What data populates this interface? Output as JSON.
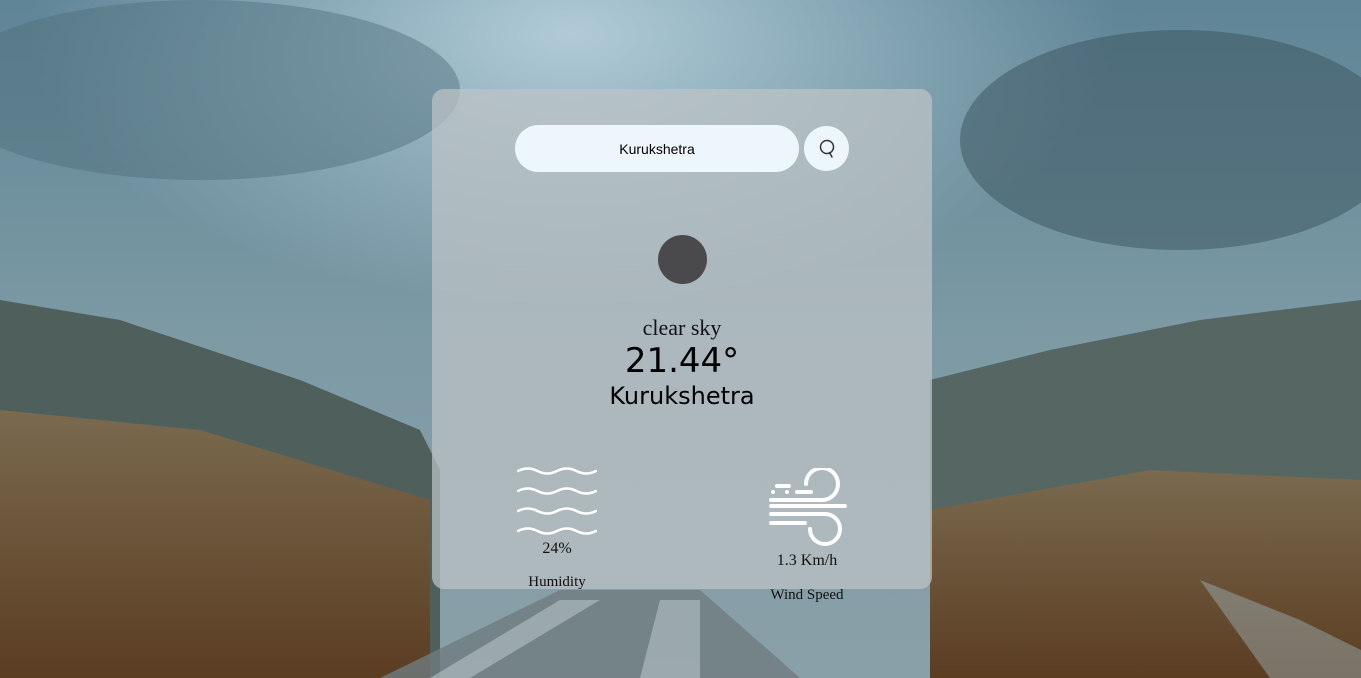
{
  "search": {
    "value": "Kurukshetra",
    "icon": "search-icon"
  },
  "weather": {
    "icon": "clear-sky-icon",
    "description": "clear sky",
    "temperature": "21.44°",
    "city": "Kurukshetra"
  },
  "humidity": {
    "icon": "humidity-icon",
    "value": "24%",
    "label": "Humidity"
  },
  "wind": {
    "icon": "wind-icon",
    "value": "1.3 Km/h",
    "label": "Wind Speed"
  },
  "colors": {
    "card": "#bec4c6",
    "input": "#eef6fd",
    "weather_icon": "#4a4a4c",
    "text": "#000000"
  }
}
